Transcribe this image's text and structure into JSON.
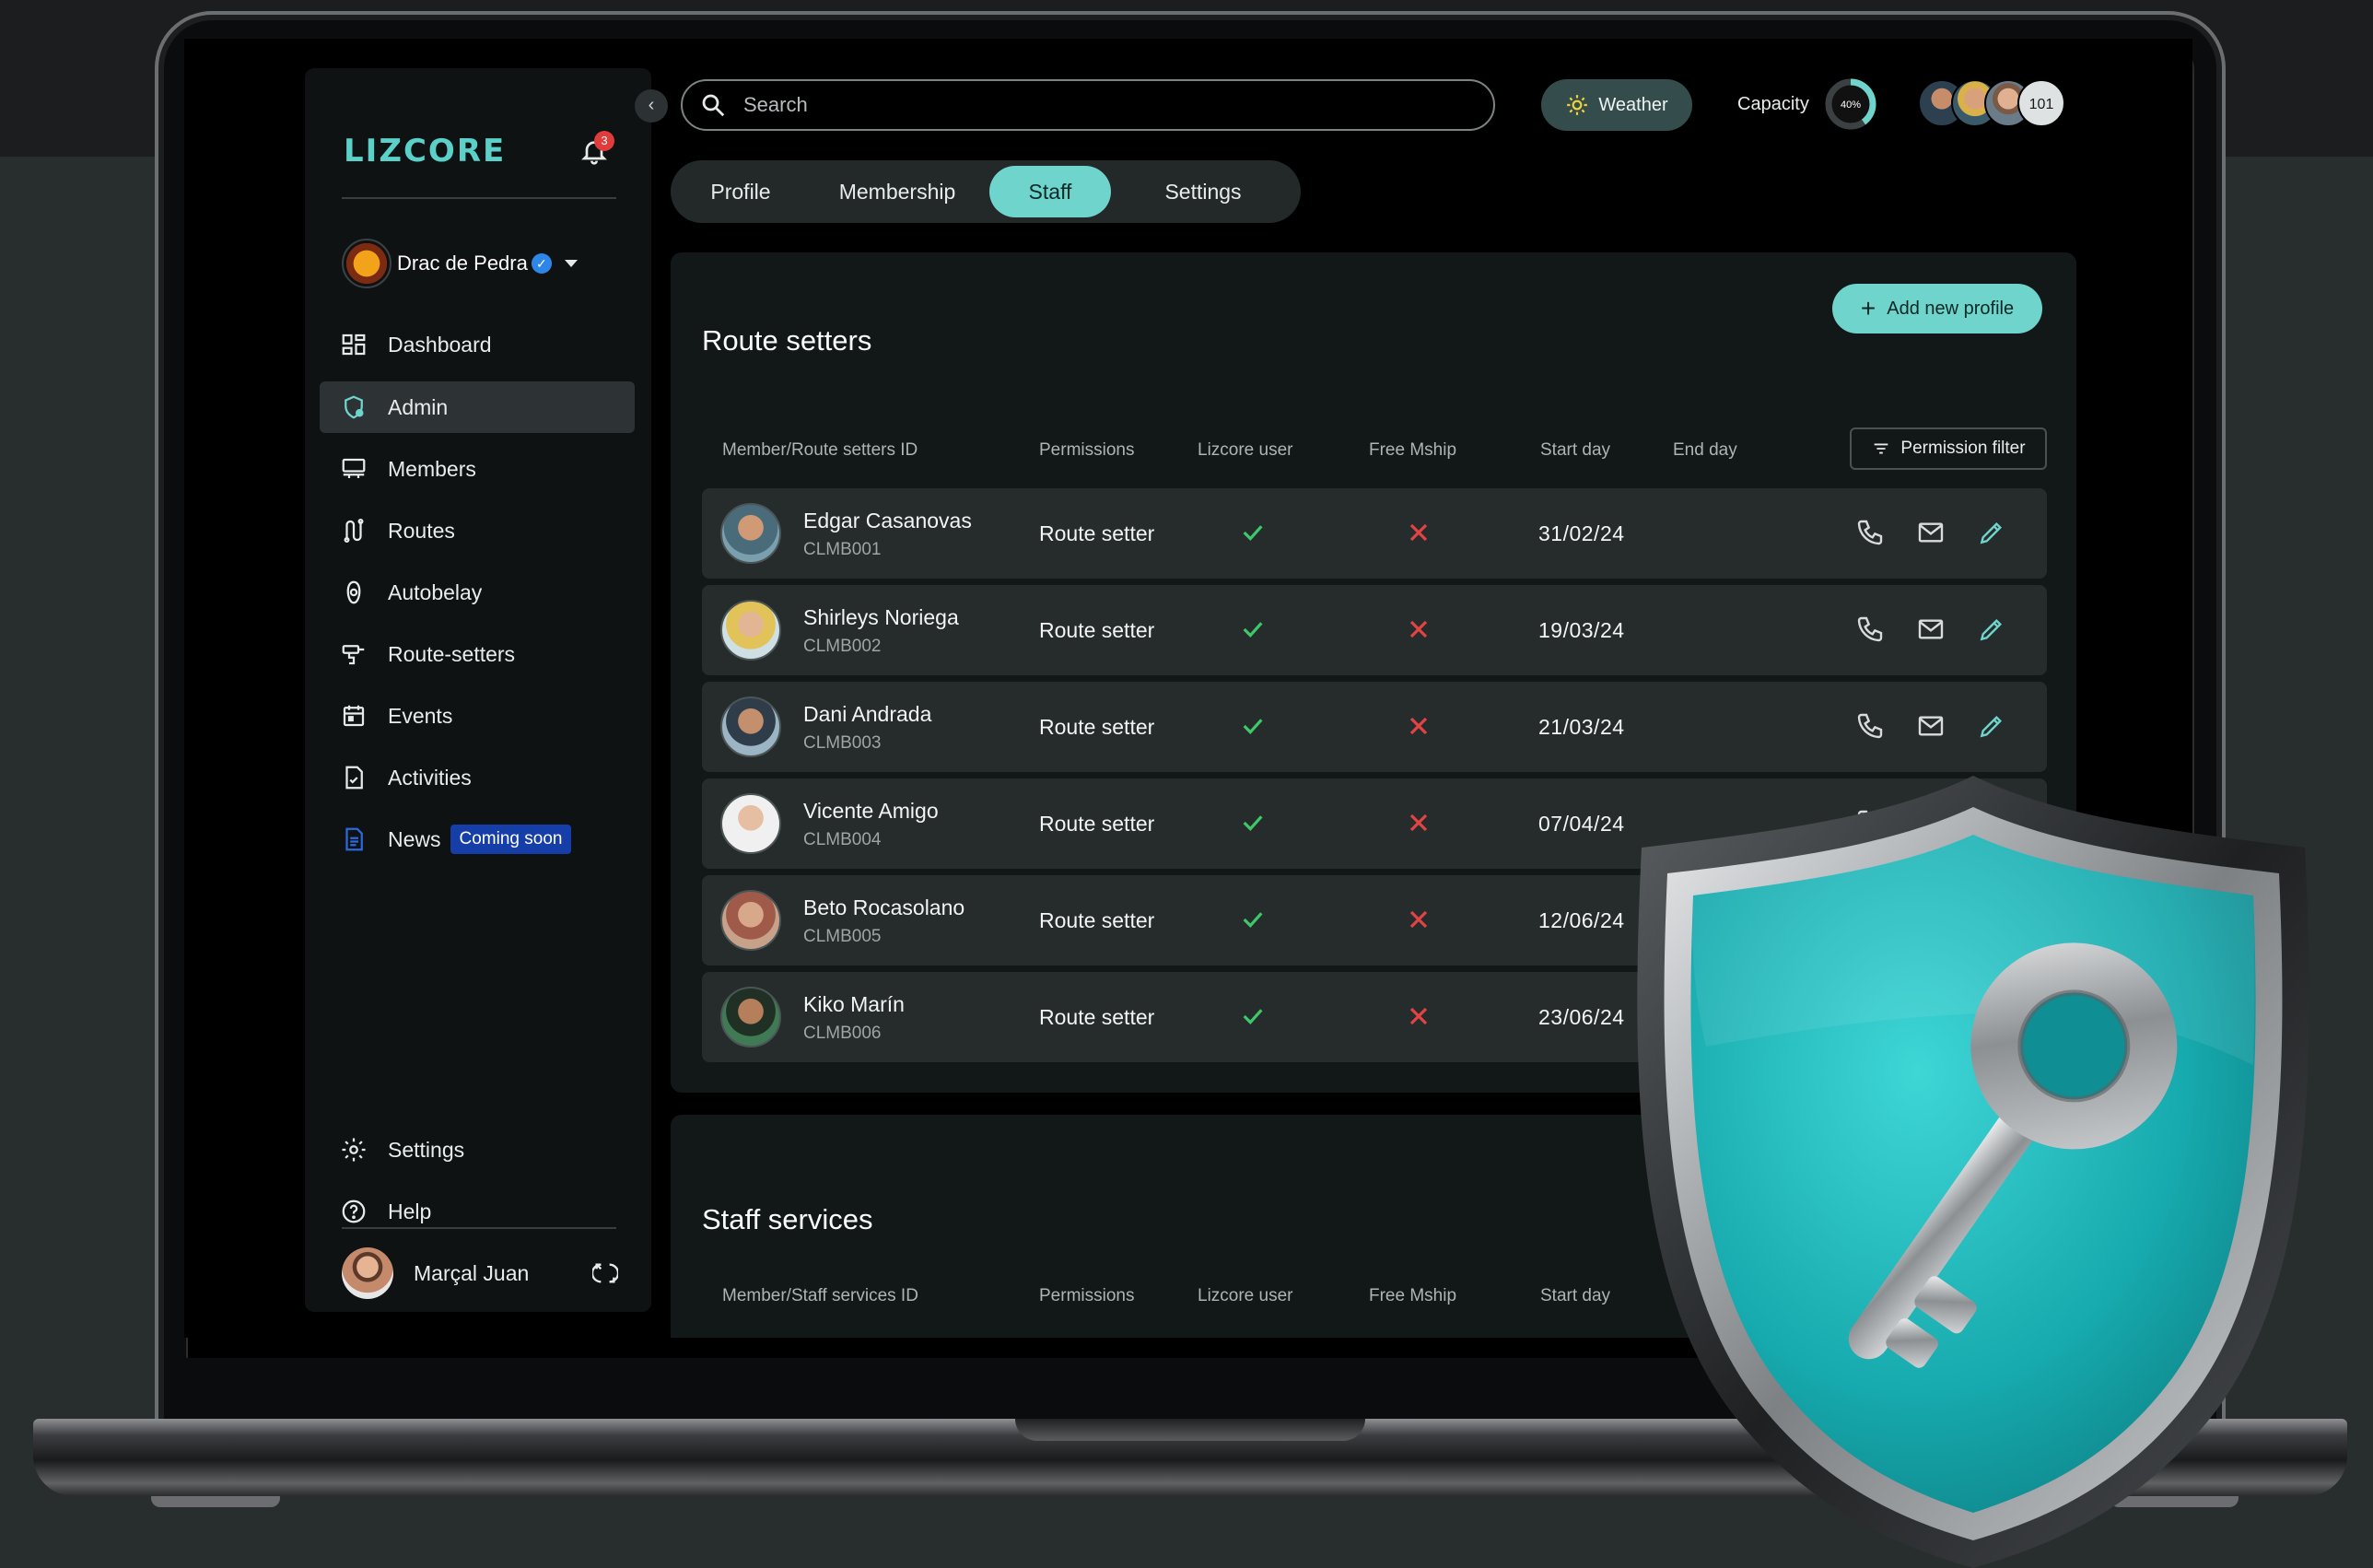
{
  "brand": {
    "logo": "LIZCORE",
    "accent": "#6fd4cc",
    "notification_count": "3"
  },
  "gym": {
    "name": "Drac de Pedra",
    "logo_text": "DRAC DE PEDRA"
  },
  "sidebar": {
    "items": [
      {
        "label": "Dashboard",
        "icon": "dashboard-icon"
      },
      {
        "label": "Admin",
        "icon": "admin-shield-icon",
        "active": true
      },
      {
        "label": "Members",
        "icon": "members-icon"
      },
      {
        "label": "Routes",
        "icon": "routes-icon"
      },
      {
        "label": "Autobelay",
        "icon": "autobelay-icon"
      },
      {
        "label": "Route-setters",
        "icon": "drill-icon"
      },
      {
        "label": "Events",
        "icon": "calendar-icon"
      },
      {
        "label": "Activities",
        "icon": "activities-icon"
      },
      {
        "label": "News",
        "icon": "news-icon",
        "badge": "Coming soon"
      }
    ],
    "bottom": [
      {
        "label": "Settings",
        "icon": "gear-icon"
      },
      {
        "label": "Help",
        "icon": "help-icon"
      }
    ],
    "user": {
      "name": "Marçal Juan"
    }
  },
  "topbar": {
    "search_placeholder": "Search",
    "weather_label": "Weather",
    "capacity_label": "Capacity",
    "capacity_value": "40%",
    "capacity_fraction": 0.4,
    "online_count": "101"
  },
  "tabs": [
    "Profile",
    "Membership",
    "Staff",
    "Settings"
  ],
  "active_tab": "Staff",
  "route_setters": {
    "title": "Route setters",
    "add_button": "Add new profile",
    "filter_button": "Permission filter",
    "columns": [
      "Member/Route setters ID",
      "Permissions",
      "Lizcore user",
      "Free Mship",
      "Start day",
      "End day"
    ],
    "rows": [
      {
        "name": "Edgar Casanovas",
        "id": "CLMB001",
        "permission": "Route setter",
        "lizcore_user": true,
        "free_mship": false,
        "start": "31/02/24",
        "end": ""
      },
      {
        "name": "Shirleys Noriega",
        "id": "CLMB002",
        "permission": "Route setter",
        "lizcore_user": true,
        "free_mship": false,
        "start": "19/03/24",
        "end": ""
      },
      {
        "name": "Dani Andrada",
        "id": "CLMB003",
        "permission": "Route setter",
        "lizcore_user": true,
        "free_mship": false,
        "start": "21/03/24",
        "end": ""
      },
      {
        "name": "Vicente Amigo",
        "id": "CLMB004",
        "permission": "Route setter",
        "lizcore_user": true,
        "free_mship": false,
        "start": "07/04/24",
        "end": ""
      },
      {
        "name": "Beto Rocasolano",
        "id": "CLMB005",
        "permission": "Route setter",
        "lizcore_user": true,
        "free_mship": false,
        "start": "12/06/24",
        "end": ""
      },
      {
        "name": "Kiko Marín",
        "id": "CLMB006",
        "permission": "Route setter",
        "lizcore_user": true,
        "free_mship": false,
        "start": "23/06/24",
        "end": ""
      }
    ]
  },
  "staff_services": {
    "title": "Staff services",
    "columns": [
      "Member/Staff services ID",
      "Permissions",
      "Lizcore user",
      "Free Mship",
      "Start day"
    ]
  },
  "colors": {
    "check": "#3ec86a",
    "cross": "#e04444",
    "shield": "#1fb3b3"
  }
}
